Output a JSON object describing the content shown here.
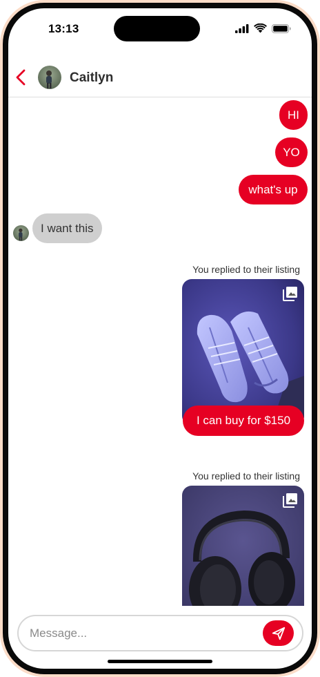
{
  "status_bar": {
    "time": "13:13",
    "battery_icon": "battery-icon",
    "wifi_icon": "wifi-icon",
    "signal_icon": "cellular-signal-icon"
  },
  "header": {
    "contact_name": "Caitlyn",
    "back_icon": "chevron-left-icon"
  },
  "thread": {
    "outgoing": [
      "HI",
      "YO",
      "what's up"
    ],
    "incoming": [
      "I want this"
    ],
    "listing_replies": [
      {
        "label": "You replied to their listing",
        "image": "white sneakers on purple carpet",
        "caption": "I can buy for $150"
      },
      {
        "label": "You replied to their listing",
        "image": "black over-ear headphones on purple fabric",
        "caption": ""
      }
    ]
  },
  "composer": {
    "placeholder": "Message...",
    "send_icon": "send-icon"
  },
  "colors": {
    "accent": "#e60023",
    "incoming_bubble": "#cfcfcf",
    "frame": "#fbdcc8"
  }
}
